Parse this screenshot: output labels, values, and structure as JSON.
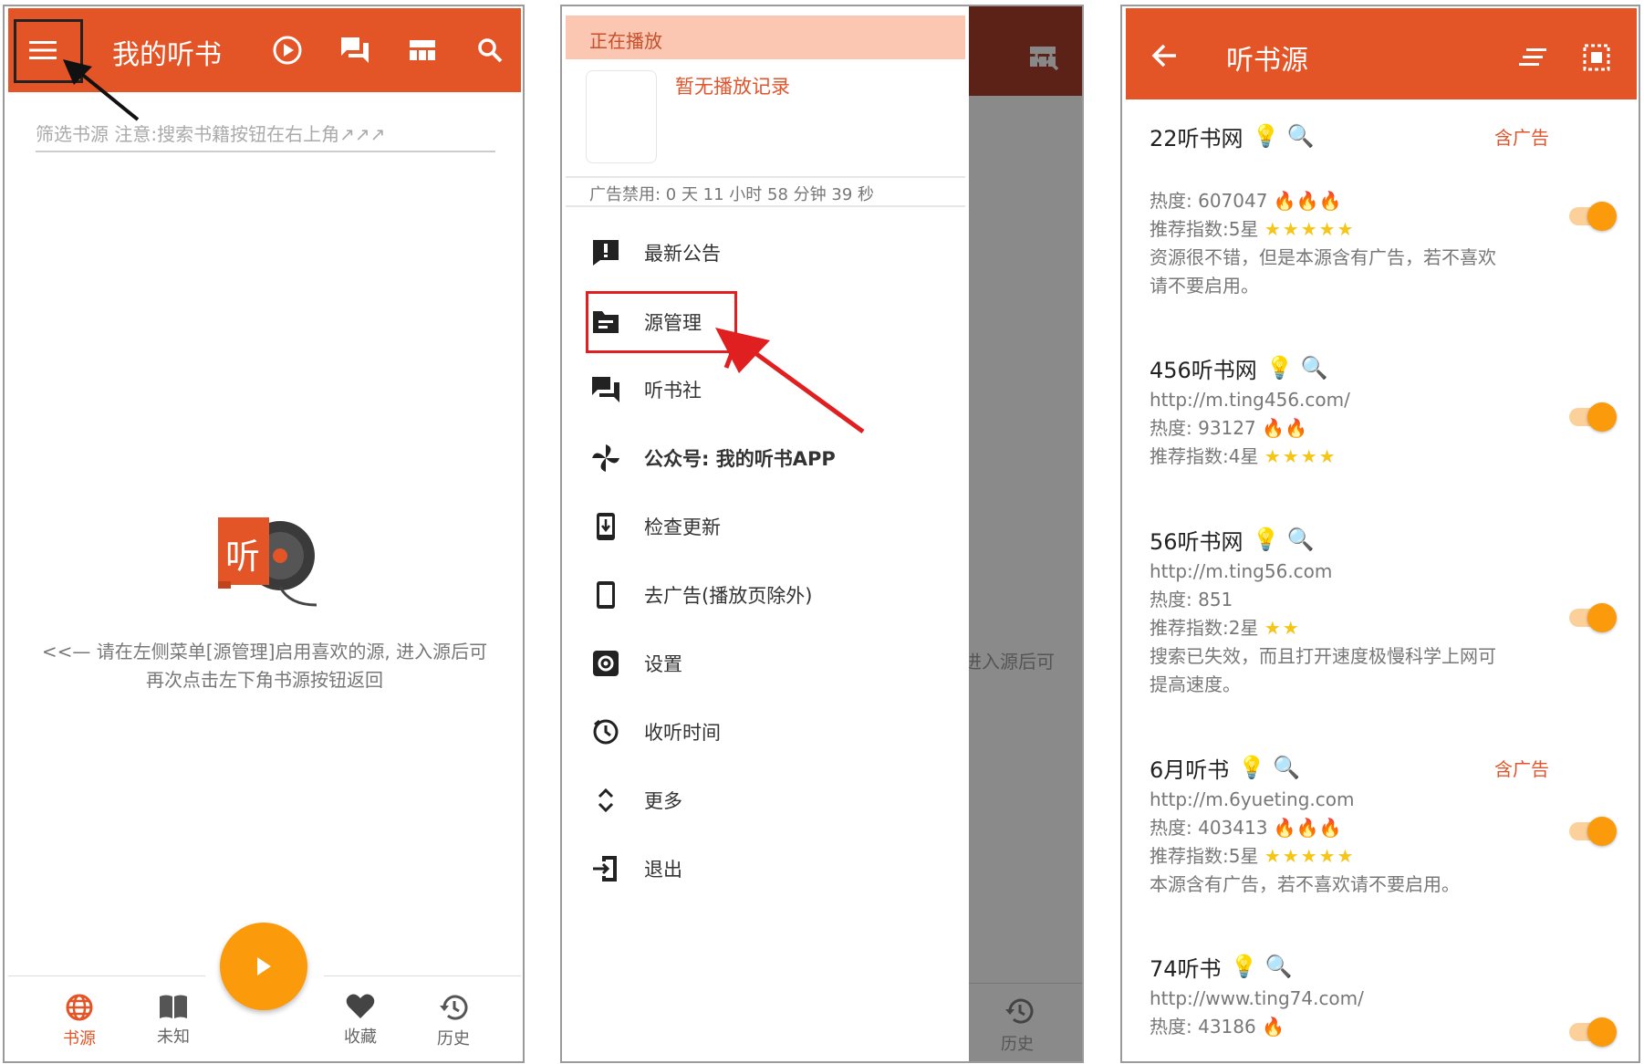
{
  "screen1": {
    "title": "我的听书",
    "filter_placeholder": "筛选书源 注意:搜索书籍按钮在右上角↗↗↗",
    "logo_char": "听",
    "empty_line1": "<<— 请在左侧菜单[源管理]启用喜欢的源, 进入源后可",
    "empty_line2": "再次点击左下角书源按钮返回",
    "nav": [
      {
        "label": "书源",
        "icon": "globe-icon",
        "active": true
      },
      {
        "label": "未知",
        "icon": "book-icon",
        "active": false
      },
      {
        "label": "收藏",
        "icon": "heart-icon",
        "active": false
      },
      {
        "label": "历史",
        "icon": "history-icon",
        "active": false
      }
    ],
    "colors": {
      "primary": "#e35427",
      "accent": "#fb9a0b"
    }
  },
  "screen2": {
    "now_playing": "正在播放",
    "no_record": "暂无播放记录",
    "ad_disabled": "广告禁用: 0 天 11 小时 58 分钟 39 秒",
    "behind_text": "进入源后可",
    "behind_nav": "历史",
    "menu": [
      {
        "label": "最新公告",
        "icon": "announcement-icon"
      },
      {
        "label": "源管理",
        "icon": "folder-icon"
      },
      {
        "label": "听书社",
        "icon": "forum-icon"
      },
      {
        "label": "公众号: 我的听书APP",
        "icon": "pinwheel-icon"
      },
      {
        "label": "检查更新",
        "icon": "update-icon"
      },
      {
        "label": "去广告(播放页除外)",
        "icon": "phone-icon"
      },
      {
        "label": "设置",
        "icon": "settings-icon"
      },
      {
        "label": "收听时间",
        "icon": "timer-icon"
      },
      {
        "label": "更多",
        "icon": "expand-icon"
      },
      {
        "label": "退出",
        "icon": "exit-icon"
      }
    ]
  },
  "screen3": {
    "title": "听书源",
    "sources": [
      {
        "name": "22听书网",
        "ad": "含广告",
        "lines": [
          "热度: 607047",
          "推荐指数:5星",
          "资源很不错，但是本源含有广告，若不喜欢",
          "请不要启用。"
        ],
        "fires": "🔥🔥🔥",
        "stars": "★★★★★",
        "enabled": true
      },
      {
        "name": "456听书网",
        "ad": "",
        "lines": [
          "http://m.ting456.com/",
          "热度: 93127",
          "推荐指数:4星"
        ],
        "fires": "🔥🔥",
        "stars": "★★★★",
        "enabled": true
      },
      {
        "name": "56听书网",
        "ad": "",
        "lines": [
          "http://m.ting56.com",
          "热度: 851",
          "推荐指数:2星",
          "搜索已失效，而且打开速度极慢科学上网可",
          "提高速度。"
        ],
        "fires": "",
        "stars": "★★",
        "enabled": true
      },
      {
        "name": "6月听书",
        "ad": "含广告",
        "lines": [
          "http://m.6yueting.com",
          "热度: 403413",
          "推荐指数:5星",
          "本源含有广告，若不喜欢请不要启用。"
        ],
        "fires": "🔥🔥🔥",
        "stars": "★★★★★",
        "enabled": true
      },
      {
        "name": "74听书",
        "ad": "",
        "lines": [
          "http://www.ting74.com/",
          "热度: 43186"
        ],
        "fires": "🔥",
        "stars": "",
        "enabled": true
      }
    ]
  }
}
